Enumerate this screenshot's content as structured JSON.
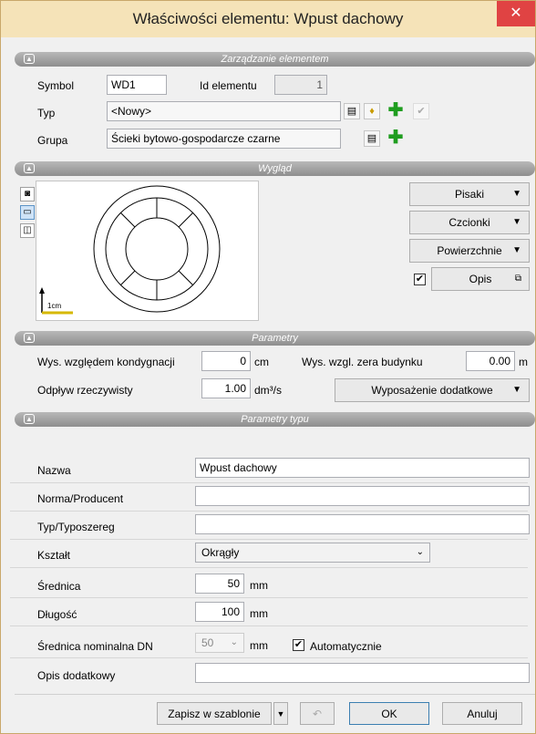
{
  "window": {
    "title": "Właściwości elementu: Wpust dachowy",
    "close": "✕"
  },
  "management": {
    "header": "Zarządzanie elementem",
    "symbol_label": "Symbol",
    "symbol_value": "WD1",
    "id_label": "Id elementu",
    "id_value": "1",
    "type_label": "Typ",
    "type_value": "<Nowy>",
    "group_label": "Grupa",
    "group_value": "Ścieki bytowo-gospodarcze czarne"
  },
  "appearance": {
    "header": "Wygląd",
    "scale_label": "1cm",
    "pens": "Pisaki",
    "fonts": "Czcionki",
    "surfaces": "Powierzchnie",
    "description": "Opis",
    "description_checked": true
  },
  "params": {
    "header": "Parametry",
    "height_label": "Wys. względem kondygnacji",
    "height_value": "0",
    "height_unit": "cm",
    "zero_label": "Wys. wzgl. zera budynku",
    "zero_value": "0.00",
    "zero_unit": "m",
    "flow_label": "Odpływ rzeczywisty",
    "flow_value": "1.00",
    "flow_unit": "dm³/s",
    "equipment": "Wyposażenie dodatkowe"
  },
  "type_params": {
    "header": "Parametry typu",
    "name_label": "Nazwa",
    "name_value": "Wpust dachowy",
    "norm_label": "Norma/Producent",
    "norm_value": "",
    "series_label": "Typ/Typoszereg",
    "series_value": "",
    "shape_label": "Kształt",
    "shape_value": "Okrągły",
    "diameter_label": "Średnica",
    "diameter_value": "50",
    "diameter_unit": "mm",
    "length_label": "Długość",
    "length_value": "100",
    "length_unit": "mm",
    "dn_label": "Średnica nominalna DN",
    "dn_value": "50",
    "dn_unit": "mm",
    "auto_label": "Automatycznie",
    "auto_checked": true,
    "extra_label": "Opis dodatkowy",
    "extra_value": ""
  },
  "footer": {
    "save_template": "Zapisz w szablonie",
    "ok": "OK",
    "cancel": "Anuluj"
  },
  "colors": {
    "title_bg": "#f5e3b8",
    "close_bg": "#e04343",
    "plus": "#1f9d1f"
  }
}
